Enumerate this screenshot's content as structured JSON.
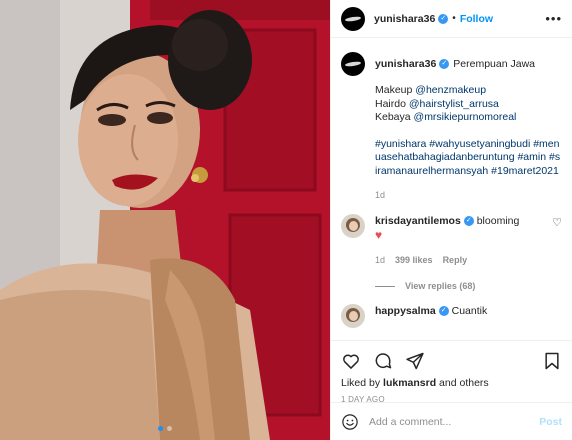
{
  "post": {
    "author": "yunishara36",
    "follow_label": "Follow",
    "separator": "•",
    "more_label": "•••",
    "location": "Perempuan Jawa",
    "caption_lines": [
      {
        "prefix": "Makeup ",
        "mention": "@henzmakeup"
      },
      {
        "prefix": "Hairdo ",
        "mention": "@hairstylist_arrusa"
      },
      {
        "prefix": "Kebaya ",
        "mention": "@mrsikiepurnomoreal"
      }
    ],
    "hashtags": "#yunishara #wahyusetyaningbudi #menuasehatbahagiadanberuntung #amin #siramanaurelhermansyah #19maret2021",
    "caption_time": "1d",
    "verified_mark": "✓"
  },
  "comments": [
    {
      "user": "krisdayantilemos",
      "text": "blooming",
      "emoji": "♥",
      "time": "1d",
      "likes": "399 likes",
      "reply_label": "Reply",
      "view_replies": "View replies (68)"
    },
    {
      "user": "happysalma",
      "text": "Cuantik"
    }
  ],
  "actions": {
    "liked_by_prefix": "Liked by ",
    "liked_by_user": "lukmansrd",
    "liked_by_suffix": " and others",
    "time_ago": "1 DAY AGO"
  },
  "composer": {
    "placeholder": "Add a comment...",
    "post_label": "Post"
  },
  "icons": {
    "like": "heart-icon",
    "comment": "comment-icon",
    "share": "share-icon",
    "save": "bookmark-icon",
    "emoji": "emoji-icon",
    "more": "more-options-icon"
  },
  "carousel": {
    "total": 2,
    "active_index": 0
  },
  "colors": {
    "link": "#00376b",
    "follow": "#0095f6",
    "verified": "#3897f0",
    "muted": "#8e8e8e",
    "heart": "#ed4956",
    "post_disabled": "#b2dffc"
  }
}
